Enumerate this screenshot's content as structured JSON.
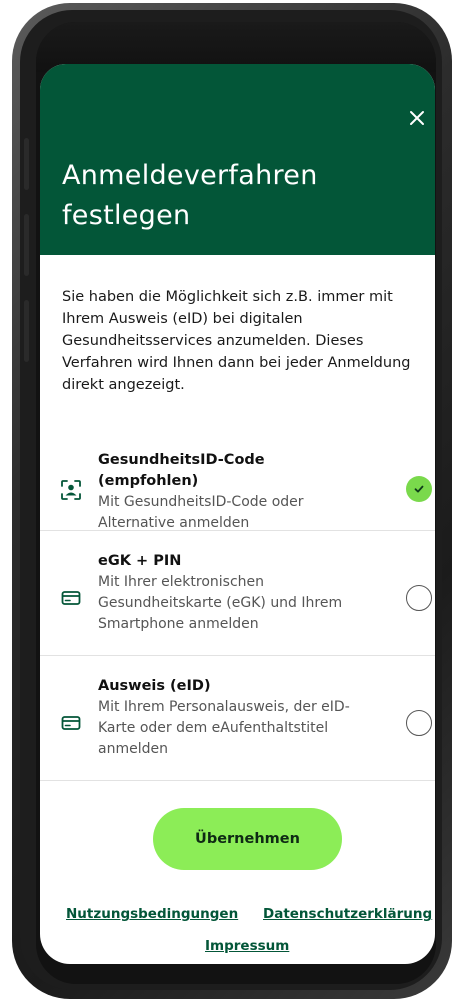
{
  "dialog": {
    "title_line1": "Anmeldeverfahren",
    "title_line2": "festlegen",
    "close_icon": "close-icon",
    "intro": "Sie haben die Möglichkeit sich z.B. immer mit Ihrem Ausweis (eID) bei digitalen Gesundheitsservices anzumelden. Dieses Verfahren wird Ihnen dann bei jeder Anmeldung direkt angezeigt."
  },
  "options": [
    {
      "title": "GesundheitsID-Code (empfohlen)",
      "description": "Mit GesundheitsID-Code oder Alternative anmelden",
      "icon": "face-scan-icon",
      "selected": true
    },
    {
      "title": "eGK + PIN",
      "description": "Mit Ihrer elektronischen Gesundheitskarte (eGK) und Ihrem Smartphone anmelden",
      "icon": "card-icon",
      "selected": false
    },
    {
      "title": "Ausweis (eID)",
      "description": "Mit Ihrem Personalausweis, der eID-Karte oder dem eAufenthaltstitel anmelden",
      "icon": "card-icon",
      "selected": false
    }
  ],
  "actions": {
    "apply_label": "Übernehmen"
  },
  "footer": {
    "terms": "Nutzungsbedingungen",
    "privacy": "Datenschutzerklärung",
    "imprint": "Impressum"
  },
  "colors": {
    "header": "#035638",
    "accent": "#8ced57",
    "selected_radio": "#7ad94c",
    "link": "#035638"
  }
}
